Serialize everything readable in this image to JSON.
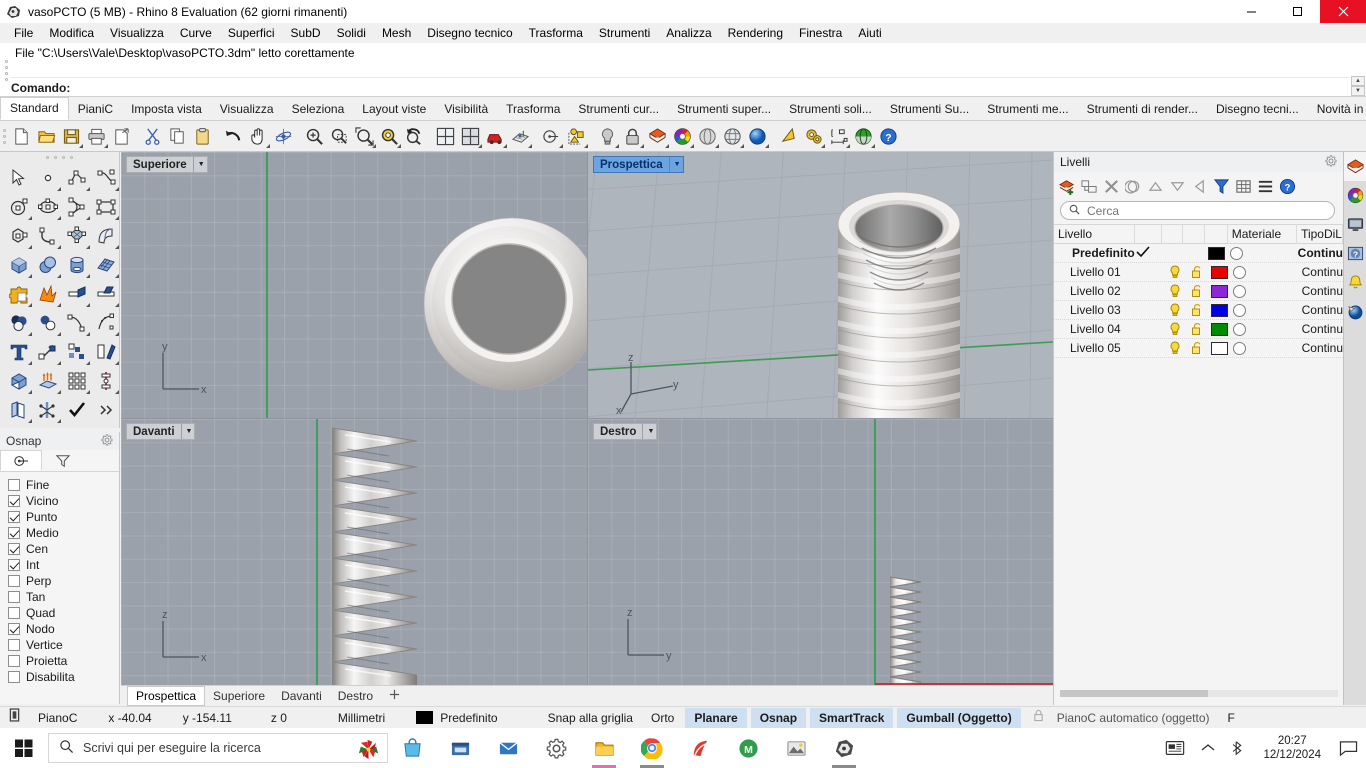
{
  "window": {
    "title": "vasoPCTO (5 MB) - Rhino 8 Evaluation (62 giorni rimanenti)",
    "minimize_label": "Riduci a icona",
    "maximize_label": "Ingrandisci",
    "close_label": "Chiudi"
  },
  "menubar": {
    "items": [
      "File",
      "Modifica",
      "Visualizza",
      "Curve",
      "Superfici",
      "SubD",
      "Solidi",
      "Mesh",
      "Disegno tecnico",
      "Trasforma",
      "Strumenti",
      "Analizza",
      "Rendering",
      "Finestra",
      "Aiuti"
    ]
  },
  "command": {
    "history": "File \"C:\\Users\\Vale\\Desktop\\vasoPCTO.3dm\" letto corettamente",
    "prompt_label": "Comando:",
    "input_value": "",
    "input_placeholder": ""
  },
  "toolbar_tabs": {
    "items": [
      "Standard",
      "PianiC",
      "Imposta vista",
      "Visualizza",
      "Seleziona",
      "Layout viste",
      "Visibilità",
      "Trasforma",
      "Strumenti cur...",
      "Strumenti super...",
      "Strumenti soli...",
      "Strumenti Su...",
      "Strumenti me...",
      "Strumenti di render...",
      "Disegno tecni...",
      "Novità in Rhin..."
    ],
    "active": "Standard",
    "gear_icon": "gear-icon"
  },
  "main_toolbar": {
    "buttons": [
      {
        "name": "new-file",
        "icon": "new-document-icon"
      },
      {
        "name": "open-file",
        "icon": "open-folder-icon"
      },
      {
        "name": "save-file",
        "icon": "floppy-save-icon"
      },
      {
        "name": "print",
        "icon": "printer-icon"
      },
      {
        "name": "export",
        "icon": "export-document-icon"
      },
      {
        "name": "cut",
        "icon": "scissors-icon"
      },
      {
        "name": "copy",
        "icon": "copy-icon"
      },
      {
        "name": "paste",
        "icon": "clipboard-paste-icon"
      },
      {
        "name": "undo",
        "icon": "undo-arrow-icon"
      },
      {
        "name": "pan",
        "icon": "hand-pan-icon"
      },
      {
        "name": "rotate-view",
        "icon": "orbit-icon"
      },
      {
        "name": "zoom-in",
        "icon": "zoom-in-magnifier-icon"
      },
      {
        "name": "zoom-window",
        "icon": "zoom-window-icon"
      },
      {
        "name": "zoom-extents",
        "icon": "zoom-extents-icon"
      },
      {
        "name": "zoom-selected",
        "icon": "zoom-selected-icon"
      },
      {
        "name": "zoom-previous",
        "icon": "zoom-previous-icon"
      },
      {
        "name": "four-viewports",
        "icon": "four-view-layout-icon"
      },
      {
        "name": "max-viewport",
        "icon": "maximize-view-icon"
      },
      {
        "name": "named-views",
        "icon": "car-view-icon"
      },
      {
        "name": "cplane",
        "icon": "cplane-grid-icon"
      },
      {
        "name": "select-circle",
        "icon": "select-circle-icon"
      },
      {
        "name": "select-objects",
        "icon": "select-objects-icon"
      },
      {
        "name": "lights",
        "icon": "lightbulb-icon"
      },
      {
        "name": "lock-object",
        "icon": "padlock-icon"
      },
      {
        "name": "layers",
        "icon": "layers-stack-icon"
      },
      {
        "name": "object-color",
        "icon": "color-wheel-icon"
      },
      {
        "name": "shaded-view",
        "icon": "shaded-sphere-icon"
      },
      {
        "name": "ghosted-view",
        "icon": "ghosted-sphere-icon"
      },
      {
        "name": "rendered-view",
        "icon": "blue-sphere-icon"
      },
      {
        "name": "render-cone",
        "icon": "render-cone-icon"
      },
      {
        "name": "options",
        "icon": "gears-options-icon"
      },
      {
        "name": "dimensions",
        "icon": "dimension-icon"
      },
      {
        "name": "analyze-surface",
        "icon": "green-sphere-analysis-icon"
      },
      {
        "name": "help",
        "icon": "help-question-icon"
      }
    ]
  },
  "left_toolbar": {
    "buttons": [
      {
        "name": "select-arrow",
        "icon": "arrow-cursor-icon"
      },
      {
        "name": "point-object",
        "icon": "point-icon"
      },
      {
        "name": "polyline",
        "icon": "polyline-icon"
      },
      {
        "name": "curve-control-points",
        "icon": "curve-icon"
      },
      {
        "name": "circle",
        "icon": "circle-icon"
      },
      {
        "name": "ellipse",
        "icon": "ellipse-icon"
      },
      {
        "name": "arc",
        "icon": "arc-icon"
      },
      {
        "name": "rectangle",
        "icon": "rectangle-icon"
      },
      {
        "name": "polygon",
        "icon": "polygon-icon"
      },
      {
        "name": "fillet-curve",
        "icon": "fillet-icon"
      },
      {
        "name": "surface-from-points",
        "icon": "surface-points-icon"
      },
      {
        "name": "surface-sweep",
        "icon": "surface-sweep-icon"
      },
      {
        "name": "box",
        "icon": "box-icon"
      },
      {
        "name": "sphere-union",
        "icon": "boolean-union-icon"
      },
      {
        "name": "cylinder",
        "icon": "cylinder-icon"
      },
      {
        "name": "surface-mesh",
        "icon": "mesh-surface-icon"
      },
      {
        "name": "boolean-difference",
        "icon": "puzzle-boolean-icon"
      },
      {
        "name": "explode",
        "icon": "explode-icon"
      },
      {
        "name": "trim",
        "icon": "trim-icon"
      },
      {
        "name": "split",
        "icon": "split-icon"
      },
      {
        "name": "boolean-3-circles",
        "icon": "three-spheres-icon"
      },
      {
        "name": "boolean-2-circles",
        "icon": "two-circles-icon"
      },
      {
        "name": "curve-edit",
        "icon": "curve-edit-icon"
      },
      {
        "name": "rebuild-curve",
        "icon": "rebuild-curve-icon"
      },
      {
        "name": "text-object",
        "icon": "text-t-icon"
      },
      {
        "name": "scale",
        "icon": "scale-arrow-icon"
      },
      {
        "name": "array",
        "icon": "array-icon"
      },
      {
        "name": "orient",
        "icon": "orient-icon"
      },
      {
        "name": "cap-solid",
        "icon": "cap-box-icon"
      },
      {
        "name": "extrude",
        "icon": "extrude-up-icon"
      },
      {
        "name": "array-grid",
        "icon": "grid-array-icon"
      },
      {
        "name": "analyze-direction",
        "icon": "direction-analysis-icon"
      },
      {
        "name": "offset-surface",
        "icon": "offset-surface-icon"
      },
      {
        "name": "kinematics",
        "icon": "kinematics-icon"
      },
      {
        "name": "check-object",
        "icon": "checkmark-icon"
      },
      {
        "name": "more-tools",
        "icon": "chevron-double-right-icon"
      }
    ]
  },
  "osnap": {
    "title": "Osnap",
    "gear_icon": "gear-icon",
    "tabs": [
      {
        "name": "osnap-tab",
        "icon": "osnap-target-icon",
        "active": true
      },
      {
        "name": "filter-tab",
        "icon": "filter-funnel-icon",
        "active": false
      }
    ],
    "items": [
      {
        "label": "Fine",
        "checked": false
      },
      {
        "label": "Vicino",
        "checked": true
      },
      {
        "label": "Punto",
        "checked": true
      },
      {
        "label": "Medio",
        "checked": true
      },
      {
        "label": "Cen",
        "checked": true
      },
      {
        "label": "Int",
        "checked": true
      },
      {
        "label": "Perp",
        "checked": false
      },
      {
        "label": "Tan",
        "checked": false
      },
      {
        "label": "Quad",
        "checked": false
      },
      {
        "label": "Nodo",
        "checked": true
      },
      {
        "label": "Vertice",
        "checked": false
      },
      {
        "label": "Proietta",
        "checked": false
      },
      {
        "label": "Disabilita",
        "checked": false
      }
    ]
  },
  "viewports": [
    {
      "name": "top",
      "label": "Superiore",
      "active": false,
      "axes": [
        "y",
        "x"
      ]
    },
    {
      "name": "persp",
      "label": "Prospettica",
      "active": true,
      "axes": [
        "z",
        "y",
        "x"
      ]
    },
    {
      "name": "front",
      "label": "Davanti",
      "active": false,
      "axes": [
        "z",
        "x"
      ]
    },
    {
      "name": "right",
      "label": "Destro",
      "active": false,
      "axes": [
        "z",
        "y"
      ]
    }
  ],
  "viewport_tabs": {
    "items": [
      "Prospettica",
      "Superiore",
      "Davanti",
      "Destro"
    ],
    "active": "Prospettica",
    "add_label": "+"
  },
  "layers_panel": {
    "title": "Livelli",
    "gear_icon": "gear-icon",
    "tools": [
      {
        "name": "new-layer",
        "icon": "new-layer-icon"
      },
      {
        "name": "new-sublayer",
        "icon": "new-sublayer-icon"
      },
      {
        "name": "delete-layer",
        "icon": "delete-x-icon"
      },
      {
        "name": "duplicate-layer",
        "icon": "duplicate-layer-icon"
      },
      {
        "name": "move-up",
        "icon": "triangle-up-icon"
      },
      {
        "name": "move-down",
        "icon": "triangle-down-icon"
      },
      {
        "name": "move-left",
        "icon": "triangle-left-icon"
      },
      {
        "name": "filter",
        "icon": "filter-funnel-icon"
      },
      {
        "name": "columns",
        "icon": "table-grid-icon"
      },
      {
        "name": "menu",
        "icon": "hamburger-menu-icon"
      },
      {
        "name": "help",
        "icon": "help-question-icon"
      }
    ],
    "search": {
      "placeholder": "Cerca",
      "value": "",
      "icon": "search-icon"
    },
    "columns": [
      "Livello",
      "",
      "",
      "",
      "",
      "Materiale",
      "TipoDiL"
    ],
    "rows": [
      {
        "name": "Predefinito",
        "current": true,
        "bulb": false,
        "lock": false,
        "color": "#000000",
        "material": "",
        "linetype": "Continu"
      },
      {
        "name": "Livello 01",
        "current": false,
        "bulb": true,
        "lock": true,
        "color": "#ea0000",
        "material": "",
        "linetype": "Continu"
      },
      {
        "name": "Livello 02",
        "current": false,
        "bulb": true,
        "lock": true,
        "color": "#8d26d9",
        "material": "",
        "linetype": "Continu"
      },
      {
        "name": "Livello 03",
        "current": false,
        "bulb": true,
        "lock": true,
        "color": "#0000e6",
        "material": "",
        "linetype": "Continu"
      },
      {
        "name": "Livello 04",
        "current": false,
        "bulb": true,
        "lock": true,
        "color": "#008a00",
        "material": "",
        "linetype": "Continu"
      },
      {
        "name": "Livello 05",
        "current": false,
        "bulb": true,
        "lock": true,
        "color": "#ffffff",
        "material": "",
        "linetype": "Continu"
      }
    ]
  },
  "rail": {
    "items": [
      {
        "name": "layers-rail",
        "icon": "layers-stack-icon",
        "selected": true
      },
      {
        "name": "colors-rail",
        "icon": "color-wheel-icon",
        "selected": false
      },
      {
        "name": "display-rail",
        "icon": "monitor-icon",
        "selected": false
      },
      {
        "name": "help-rail",
        "icon": "help-panel-icon",
        "selected": false
      },
      {
        "name": "notifications-rail",
        "icon": "bell-icon",
        "selected": false
      },
      {
        "name": "render-rail",
        "icon": "render-globe-icon",
        "selected": false
      }
    ]
  },
  "statusbar": {
    "cplane_icon": "cplane-icon",
    "cplane_label": "PianoC",
    "x": "x -40.04",
    "y": "y -154.11",
    "z": "z 0",
    "units": "Millimetri",
    "layer_swatch": "#000000",
    "layer_label": "Predefinito",
    "toggles": [
      {
        "label": "Snap alla griglia",
        "on": false
      },
      {
        "label": "Orto",
        "on": false
      },
      {
        "label": "Planare",
        "on": true
      },
      {
        "label": "Osnap",
        "on": true
      },
      {
        "label": "SmartTrack",
        "on": true
      },
      {
        "label": "Gumball (Oggetto)",
        "on": true
      }
    ],
    "lock_icon": "padlock-icon",
    "auto_cplane": "PianoC automatico (oggetto)",
    "trailing": "F"
  },
  "taskbar": {
    "start_icon": "windows-start-icon",
    "search": {
      "placeholder": "Scrivi qui per eseguire la ricerca",
      "value": "",
      "icon": "search-icon"
    },
    "cortana_icon": "poinsettia-flower-icon",
    "apps": [
      {
        "name": "store",
        "icon": "store-bag-icon",
        "active": false
      },
      {
        "name": "file-explorer",
        "icon": "folder-explorer-icon",
        "active": false
      },
      {
        "name": "mail",
        "icon": "mail-icon",
        "active": false
      },
      {
        "name": "settings",
        "icon": "gear-icon",
        "active": false
      },
      {
        "name": "files",
        "icon": "yellow-folder-icon",
        "active": true
      },
      {
        "name": "chrome",
        "icon": "chrome-icon",
        "active": true
      },
      {
        "name": "app-red",
        "icon": "red-swirl-icon",
        "active": false
      },
      {
        "name": "app-green",
        "icon": "green-circle-m-icon",
        "active": false
      },
      {
        "name": "photos",
        "icon": "photos-icon",
        "active": false
      },
      {
        "name": "rhino",
        "icon": "rhino-icon",
        "active": true
      }
    ],
    "tray": [
      {
        "name": "news-widget",
        "icon": "news-icon"
      },
      {
        "name": "show-hidden-icons",
        "icon": "chevron-up-icon"
      },
      {
        "name": "bluetooth",
        "icon": "bluetooth-icon"
      }
    ],
    "clock": {
      "time": "20:27",
      "date": "12/12/2024"
    },
    "action_center_icon": "speech-bubble-icon"
  }
}
